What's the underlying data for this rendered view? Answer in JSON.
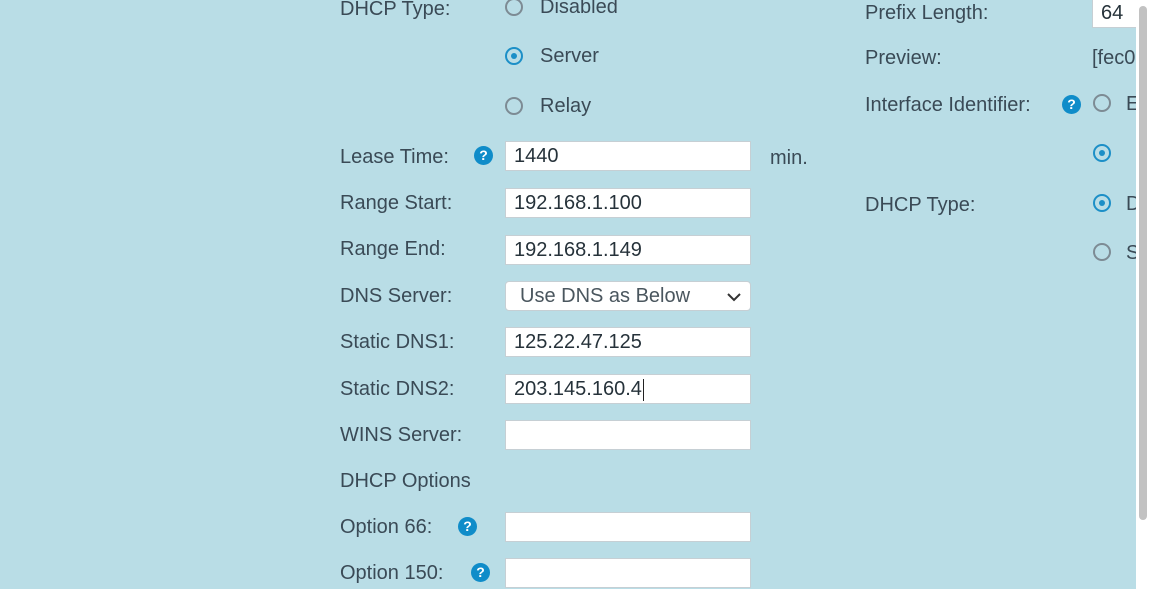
{
  "left": {
    "dhcp_type": {
      "label": "DHCP Type:",
      "options": [
        {
          "label": "Disabled",
          "checked": false
        },
        {
          "label": "Server",
          "checked": true
        },
        {
          "label": "Relay",
          "checked": false
        }
      ]
    },
    "lease_time": {
      "label": "Lease Time:",
      "value": "1440",
      "unit": "min."
    },
    "range_start": {
      "label": "Range Start:",
      "value": "192.168.1.100"
    },
    "range_end": {
      "label": "Range End:",
      "value": "192.168.1.149"
    },
    "dns_server": {
      "label": "DNS Server:",
      "selected": "Use DNS as Below"
    },
    "static_dns1": {
      "label": "Static DNS1:",
      "value": "125.22.47.125"
    },
    "static_dns2": {
      "label": "Static DNS2:",
      "value": "203.145.160.4"
    },
    "wins_server": {
      "label": "WINS Server:",
      "value": ""
    },
    "dhcp_options": {
      "heading": "DHCP Options"
    },
    "option66": {
      "label": "Option 66:",
      "value": ""
    },
    "option150": {
      "label": "Option 150:",
      "value": ""
    }
  },
  "right": {
    "prefix_length": {
      "label": "Prefix Length:",
      "value": "64"
    },
    "preview": {
      "label": "Preview:",
      "value": "[fec0"
    },
    "interface_identifier": {
      "label": "Interface Identifier:",
      "options": [
        {
          "label": "E",
          "checked": false
        },
        {
          "label": "",
          "checked": true
        }
      ]
    },
    "dhcp_type": {
      "label": "DHCP Type:",
      "options": [
        {
          "label": "D",
          "checked": true
        },
        {
          "label": "S",
          "checked": false
        }
      ]
    }
  },
  "help_glyph": "?",
  "colors": {
    "background": "#b9dde6",
    "accent": "#1c8fc7",
    "help": "#0f8cc9"
  }
}
